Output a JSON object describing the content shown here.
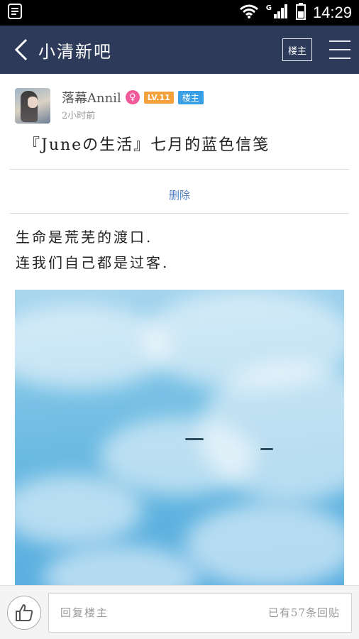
{
  "status_bar": {
    "time": "14:29",
    "network_label": "G",
    "icons": [
      "clipboard-icon",
      "wifi-icon",
      "signal-icon",
      "battery-icon"
    ]
  },
  "header": {
    "title": "小清新吧",
    "op_button_label": "楼主",
    "background_color": "#2d3a59"
  },
  "post": {
    "author_name": "落幕Annil",
    "gender_symbol": "♀",
    "level": "LV.11",
    "op_badge": "楼主",
    "time": "2小时前",
    "title": "『Juneの生活』七月的蓝色信笺",
    "delete_label": "删除",
    "body_lines": [
      "生命是荒芜的渡口.",
      "连我们自己都是过客."
    ],
    "image_description_icon": "sky-photo"
  },
  "reply_bar": {
    "placeholder": "回复楼主",
    "count_text": "已有57条回贴"
  }
}
